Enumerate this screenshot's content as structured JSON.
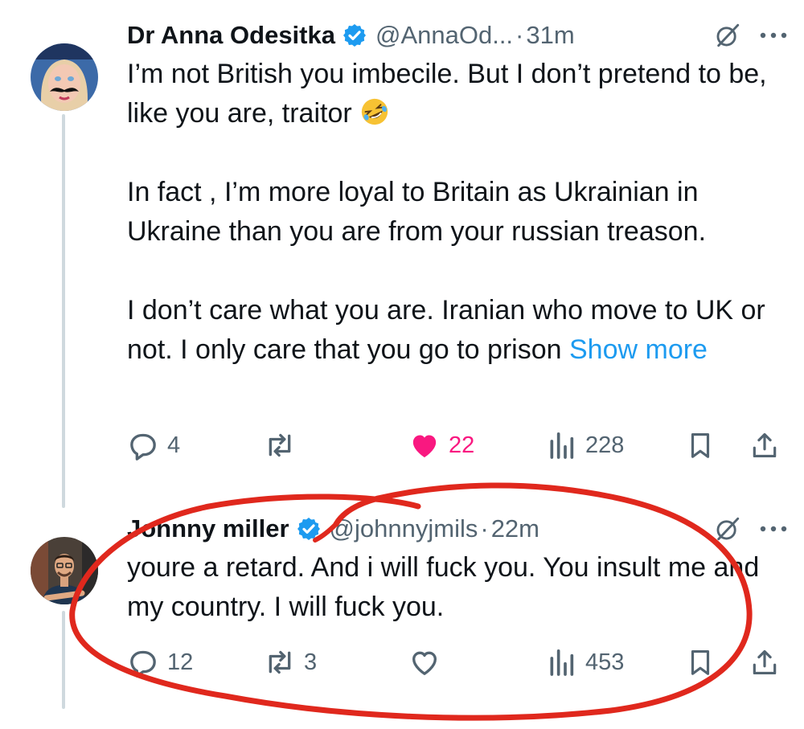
{
  "tweets": [
    {
      "author_name": "Dr Anna Odesitka",
      "handle": "@AnnaOd...",
      "separator": "·",
      "time": "31m",
      "body_paragraphs": [
        "I’m not British you imbecile. But I don’t pretend to be, like you are, traitor",
        "In fact , I’m more loyal to Britain as Ukrainian in Ukraine than you are from your russian treason.",
        "I don’t care what you are. Iranian who move to UK or not. I only care that you go to prison"
      ],
      "emoji": "rolling-on-floor-laughing",
      "show_more_label": "Show more",
      "replies": "4",
      "reposts": "",
      "likes": "22",
      "liked": true,
      "views": "228"
    },
    {
      "author_name": "Johnny miller",
      "handle": "@johnnyjmils",
      "separator": "·",
      "time": "22m",
      "body_paragraphs": [
        "youre a retard. And i will fuck you. You insult me and my country. I will fuck you."
      ],
      "replies": "12",
      "reposts": "3",
      "likes": "",
      "liked": false,
      "views": "453"
    }
  ],
  "icons": [
    "verified-badge-icon",
    "grok-icon",
    "more-icon",
    "reply-icon",
    "repost-icon",
    "heart-icon",
    "views-icon",
    "bookmark-icon",
    "share-icon"
  ],
  "colors": {
    "accent": "#1d9bf0",
    "like": "#f91880",
    "secondary_text": "#536471",
    "annotation": "#e0281d"
  }
}
